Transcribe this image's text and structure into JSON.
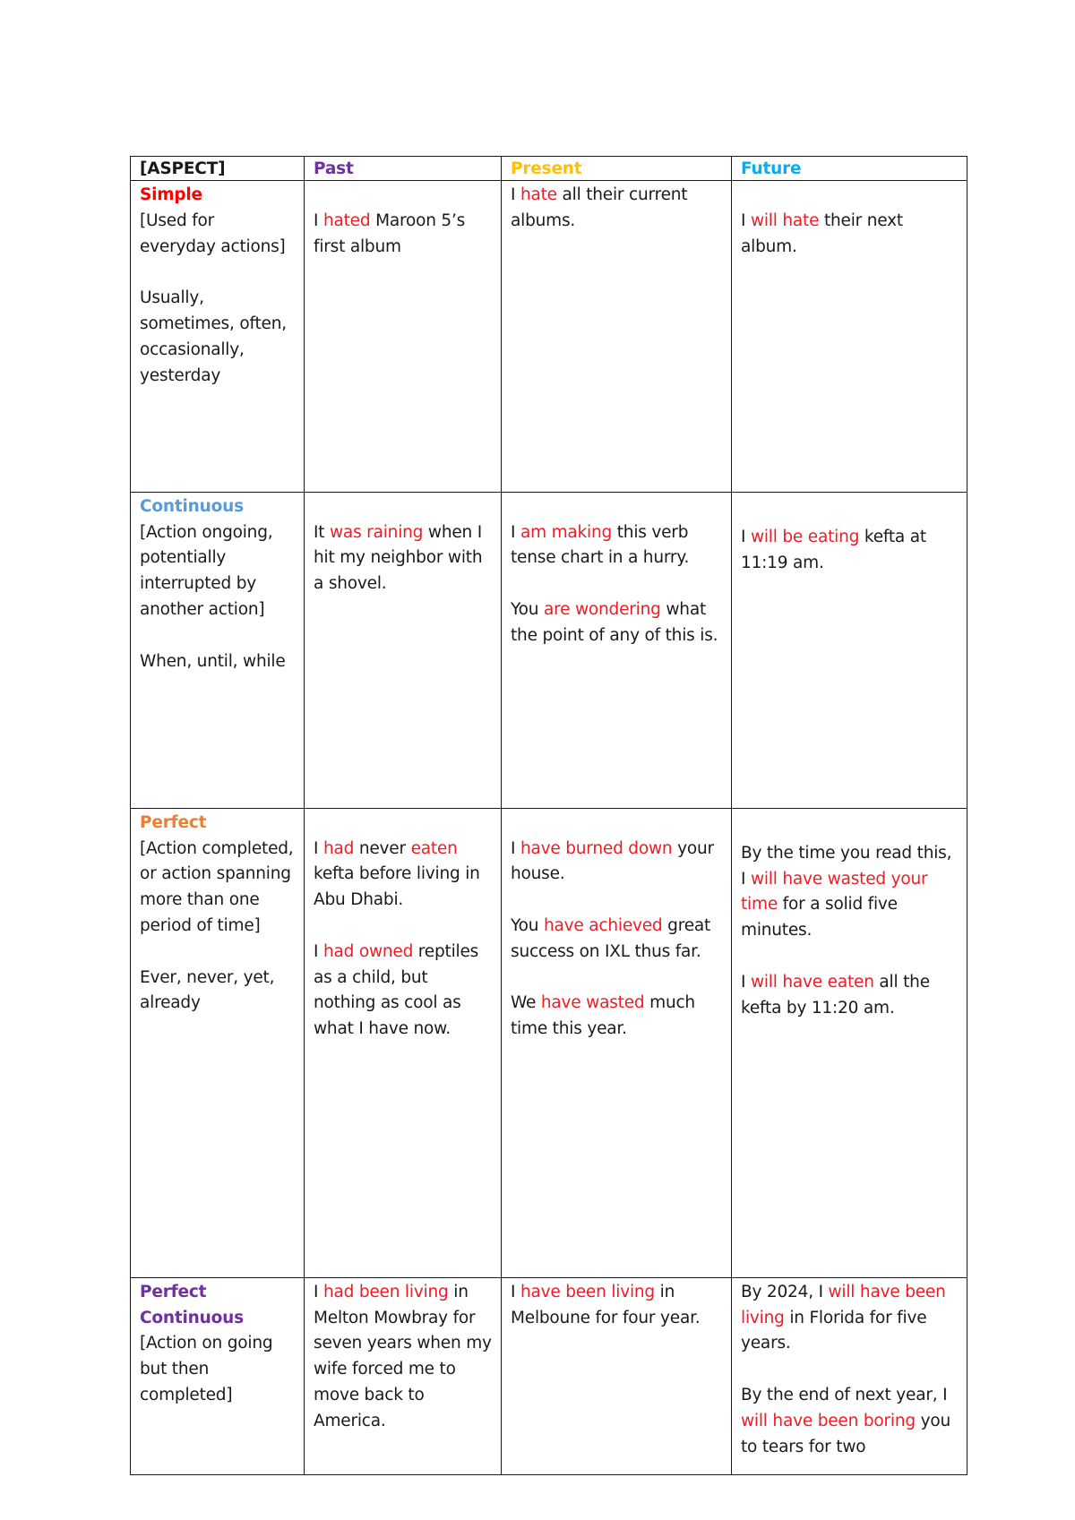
{
  "colors": {
    "past": "#7030a0",
    "present": "#ffc000",
    "future": "#00b0f0",
    "simple": "#ff0000",
    "continuous": "#5b9bd5",
    "perfect": "#ed7d31",
    "perfect_continuous": "#7030a0",
    "verb_highlight": "#ee1c24"
  },
  "header": {
    "aspect": "[ASPECT]",
    "past": "Past",
    "present": "Present",
    "future": "Future"
  },
  "rows": [
    {
      "aspect": {
        "title": "Simple",
        "description": "[Used for everyday actions]",
        "keywords": "Usually, sometimes, often, occasionally, yesterday"
      },
      "past": [
        {
          "pre": "I ",
          "verb": "hated",
          "post": " Maroon 5’s first album"
        }
      ],
      "present": [
        {
          "pre": "I ",
          "verb": "hate",
          "post": " all their current albums."
        }
      ],
      "future": [
        {
          "pre": "I ",
          "verb": "will hate",
          "post": " their next album."
        }
      ]
    },
    {
      "aspect": {
        "title": "Continuous",
        "description": "[Action ongoing, potentially interrupted by another action]",
        "keywords": "When, until, while"
      },
      "past": [
        {
          "pre": "It ",
          "verb": "was raining",
          "post": " when I hit my neighbor with a shovel."
        }
      ],
      "present": [
        {
          "pre": "I ",
          "verb": "am making",
          "post": " this verb tense chart in a hurry."
        },
        {
          "pre": "You ",
          "verb": "are wondering",
          "post": " what the point of any of this is."
        }
      ],
      "future": [
        {
          "pre": "I ",
          "verb": "will be eating",
          "post": " kefta at 11:19 am."
        }
      ]
    },
    {
      "aspect": {
        "title": "Perfect",
        "description": "[Action completed, or action spanning more than one period of time]",
        "keywords": "Ever, never, yet, already"
      },
      "past": [
        {
          "pre": "I ",
          "verb": "had",
          "mid": " never ",
          "verb2": "eaten",
          "post": " kefta before living in Abu Dhabi."
        },
        {
          "pre": "I ",
          "verb": "had owned",
          "post": " reptiles as a child, but nothing as cool as what I have now."
        }
      ],
      "present": [
        {
          "pre": "I ",
          "verb": "have burned down",
          "post": " your house."
        },
        {
          "pre": "You ",
          "verb": "have achieved",
          "post": " great success on IXL thus far."
        },
        {
          "pre": "We ",
          "verb": "have wasted",
          "post": " much time this year."
        }
      ],
      "future": [
        {
          "pre": "By the time you read this, I ",
          "verb": "will have wasted your time",
          "post": " for a solid five minutes."
        },
        {
          "pre": "I ",
          "verb": "will have eaten",
          "post": " all the kefta by 11:20 am."
        }
      ]
    },
    {
      "aspect": {
        "title": "Perfect Continuous",
        "description": "[Action on going but then completed]",
        "keywords": ""
      },
      "past": [
        {
          "pre": "I ",
          "verb": "had been living",
          "post": " in Melton Mowbray for seven years when my wife forced me to move back to America."
        }
      ],
      "present": [
        {
          "pre": "I ",
          "verb": "have been living",
          "post": " in Melboune for four year."
        }
      ],
      "future": [
        {
          "pre": "By 2024, I ",
          "verb": "will have been living",
          "post": " in Florida for five years."
        },
        {
          "pre": "By the end of next year, I ",
          "verb": "will have been boring",
          "post": " you to tears for two"
        }
      ]
    }
  ]
}
